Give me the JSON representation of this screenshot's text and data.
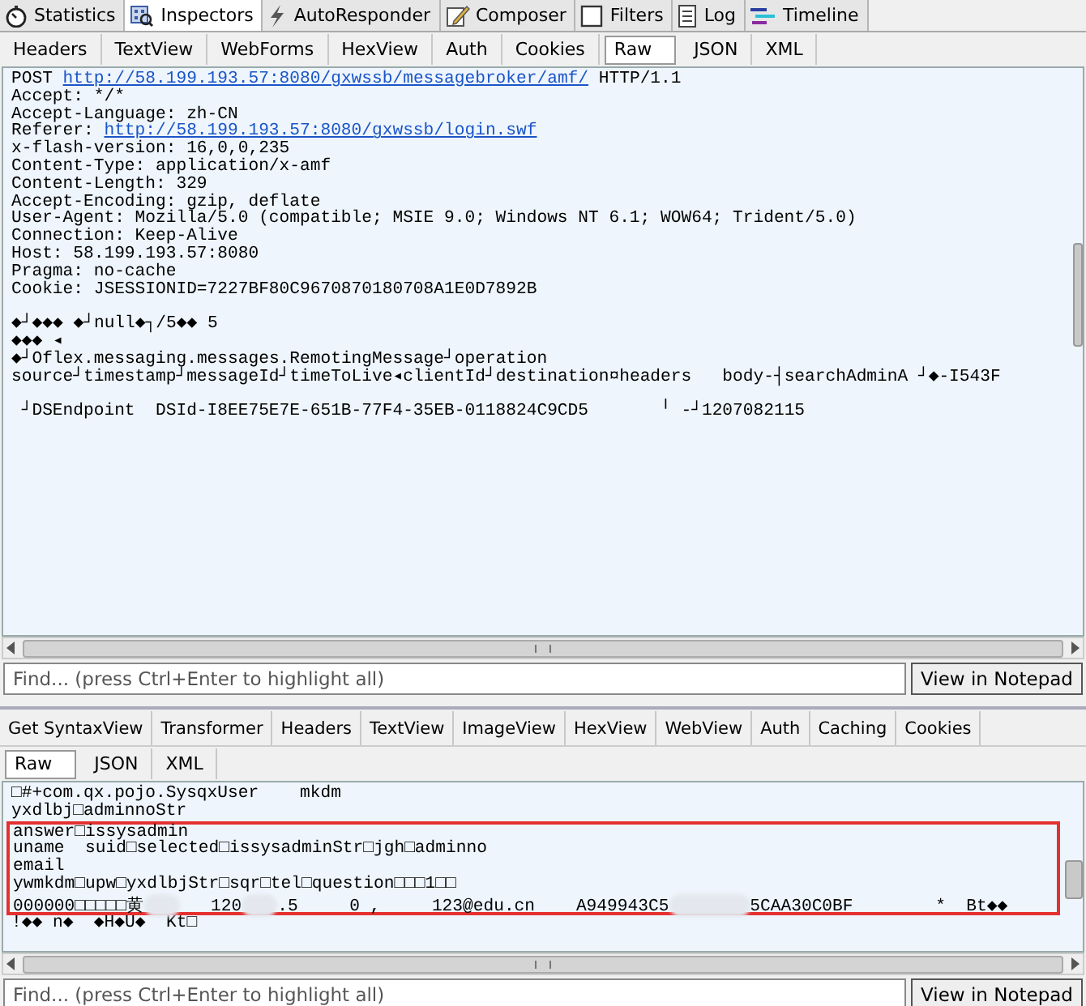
{
  "main_tabs": [
    {
      "label": "Statistics",
      "selected": false
    },
    {
      "label": "Inspectors",
      "selected": true
    },
    {
      "label": "AutoResponder",
      "selected": false
    },
    {
      "label": "Composer",
      "selected": false
    },
    {
      "label": "Filters",
      "selected": false
    },
    {
      "label": "Log",
      "selected": false
    },
    {
      "label": "Timeline",
      "selected": false
    }
  ],
  "request": {
    "tabs": [
      {
        "label": "Headers",
        "selected": false
      },
      {
        "label": "TextView",
        "selected": false
      },
      {
        "label": "WebForms",
        "selected": false
      },
      {
        "label": "HexView",
        "selected": false
      },
      {
        "label": "Auth",
        "selected": false
      },
      {
        "label": "Cookies",
        "selected": false
      }
    ],
    "format_tabs": [
      {
        "label": "Raw",
        "selected": true
      },
      {
        "label": "JSON",
        "selected": false
      },
      {
        "label": "XML",
        "selected": false
      }
    ],
    "lines": [
      [
        {
          "kind": "text",
          "text": "POST "
        },
        {
          "kind": "link",
          "text": "http://58.199.193.57:8080/gxwssb/messagebroker/amf/"
        },
        {
          "kind": "text",
          "text": " HTTP/1.1"
        }
      ],
      [
        {
          "kind": "text",
          "text": "Accept: */*"
        }
      ],
      [
        {
          "kind": "text",
          "text": "Accept-Language: zh-CN"
        }
      ],
      [
        {
          "kind": "text",
          "text": "Referer: "
        },
        {
          "kind": "link",
          "text": "http://58.199.193.57:8080/gxwssb/login.swf"
        }
      ],
      [
        {
          "kind": "text",
          "text": "x-flash-version: 16,0,0,235"
        }
      ],
      [
        {
          "kind": "text",
          "text": "Content-Type: application/x-amf"
        }
      ],
      [
        {
          "kind": "text",
          "text": "Content-Length: 329"
        }
      ],
      [
        {
          "kind": "text",
          "text": "Accept-Encoding: gzip, deflate"
        }
      ],
      [
        {
          "kind": "text",
          "text": "User-Agent: Mozilla/5.0 (compatible; MSIE 9.0; Windows NT 6.1; WOW64; Trident/5.0)"
        }
      ],
      [
        {
          "kind": "text",
          "text": "Connection: Keep-Alive"
        }
      ],
      [
        {
          "kind": "text",
          "text": "Host: 58.199.193.57:8080"
        }
      ],
      [
        {
          "kind": "text",
          "text": "Pragma: no-cache"
        }
      ],
      [
        {
          "kind": "text",
          "text": "Cookie: JSESSIONID=7227BF80C9670870180708A1E0D7892B"
        }
      ],
      [
        {
          "kind": "gap"
        },
        {
          "kind": "text",
          "text": "◆┘◆◆◆ ◆┘null◆┐/5◆◆ 5"
        }
      ],
      [
        {
          "kind": "text",
          "text": "◆◆◆ ◂"
        }
      ],
      [
        {
          "kind": "text",
          "text": "◆┘Oflex.messaging.messages.RemotingMessage┘operation"
        }
      ],
      [
        {
          "kind": "text",
          "text": "source┘timestamp┘messageId┘timeToLive◂clientId┘destination¤headers   body-┤searchAdminA ┘◆-I543F"
        }
      ],
      [
        {
          "kind": "gap"
        },
        {
          "kind": "text",
          "text": " ┘DSEndpoint  DSId-I8EE75E7E-651B-77F4-35EB-0118824C9CD5       ╵ -┘1207082115"
        }
      ]
    ],
    "find_placeholder": "Find... (press Ctrl+Enter to highlight all)",
    "notepad_button": "View in Notepad"
  },
  "response": {
    "tabs": [
      {
        "label": "Get SyntaxView",
        "selected": false
      },
      {
        "label": "Transformer",
        "selected": false
      },
      {
        "label": "Headers",
        "selected": false
      },
      {
        "label": "TextView",
        "selected": false
      },
      {
        "label": "ImageView",
        "selected": false
      },
      {
        "label": "HexView",
        "selected": false
      },
      {
        "label": "WebView",
        "selected": false
      },
      {
        "label": "Auth",
        "selected": false
      },
      {
        "label": "Caching",
        "selected": false
      },
      {
        "label": "Cookies",
        "selected": false
      }
    ],
    "format_tabs": [
      {
        "label": "Raw",
        "selected": true
      },
      {
        "label": "JSON",
        "selected": false
      },
      {
        "label": "XML",
        "selected": false
      }
    ],
    "lines_before": [
      [
        {
          "kind": "text",
          "text": "□#+com.qx.pojo.SysqxUser    mkdm"
        }
      ],
      [
        {
          "kind": "text",
          "text": "yxdlbj□adminnoStr"
        }
      ]
    ],
    "highlighted_lines": [
      [
        {
          "kind": "text",
          "text": "answer□issysadmin"
        }
      ],
      [
        {
          "kind": "text",
          "text": "uname  suid□selected□issysadminStr□jgh□adminno"
        }
      ],
      [
        {
          "kind": "text",
          "text": "email"
        }
      ],
      [
        {
          "kind": "text",
          "text": "ywmkdm□upw□yxdlbjStr□sqr□tel□question□□□1□□"
        }
      ],
      [
        {
          "kind": "text",
          "text": "000000□□□□□黄"
        },
        {
          "kind": "redacted"
        },
        {
          "kind": "text",
          "text": "   120"
        },
        {
          "kind": "redacted"
        },
        {
          "kind": "text",
          "text": ".5     0 ,     123@edu.cn    A949943C5"
        },
        {
          "kind": "redacted"
        },
        {
          "kind": "text",
          "text": "5CAA30C0BF        *  Bt◆◆"
        }
      ]
    ],
    "lines_after": [
      [
        {
          "kind": "text",
          "text": "!◆◆ n◆  ◆H◆U◆  Kt□"
        }
      ]
    ],
    "find_placeholder": "Find... (press Ctrl+Enter to highlight all)",
    "notepad_button": "View in Notepad"
  }
}
